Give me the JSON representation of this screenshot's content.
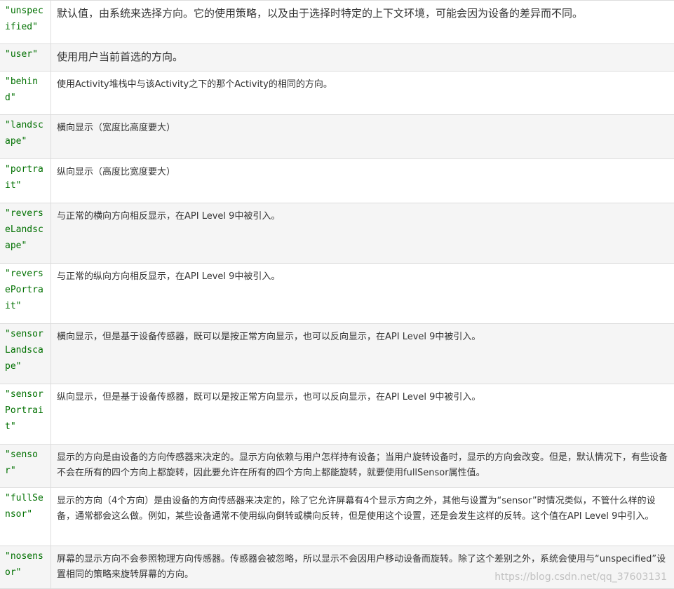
{
  "rows": [
    {
      "key": "\"unspecified\"",
      "desc": "默认值，由系统来选择方向。它的使用策略，以及由于选择时特定的上下文环境，可能会因为设备的差异而不同。"
    },
    {
      "key": "\"user\"",
      "desc": "使用用户当前首选的方向。"
    },
    {
      "key": "\"behind\"",
      "desc": "使用Activity堆栈中与该Activity之下的那个Activity的相同的方向。"
    },
    {
      "key": "\"landscape\"",
      "desc": "横向显示（宽度比高度要大）"
    },
    {
      "key": "\"portrait\"",
      "desc": "纵向显示（高度比宽度要大）"
    },
    {
      "key": "\"reverseLandscape\"",
      "desc": "与正常的横向方向相反显示，在API Level 9中被引入。"
    },
    {
      "key": "\"reversePortrait\"",
      "desc": "与正常的纵向方向相反显示，在API Level 9中被引入。"
    },
    {
      "key": "\"sensorLandscape\"",
      "desc": "横向显示，但是基于设备传感器，既可以是按正常方向显示，也可以反向显示，在API Level 9中被引入。"
    },
    {
      "key": "\"sensorPortrait\"",
      "desc": "纵向显示，但是基于设备传感器，既可以是按正常方向显示，也可以反向显示，在API Level 9中被引入。"
    },
    {
      "key": "\"sensor\"",
      "desc": "显示的方向是由设备的方向传感器来决定的。显示方向依赖与用户怎样持有设备；当用户旋转设备时，显示的方向会改变。但是，默认情况下，有些设备不会在所有的四个方向上都旋转，因此要允许在所有的四个方向上都能旋转，就要使用fullSensor属性值。"
    },
    {
      "key": "\"fullSensor\"",
      "desc": "显示的方向（4个方向）是由设备的方向传感器来决定的，除了它允许屏幕有4个显示方向之外，其他与设置为“sensor”时情况类似，不管什么样的设备，通常都会这么做。例如，某些设备通常不使用纵向倒转或横向反转，但是使用这个设置，还是会发生这样的反转。这个值在API Level 9中引入。"
    },
    {
      "key": "\"nosensor\"",
      "desc": "屏幕的显示方向不会参照物理方向传感器。传感器会被忽略，所以显示不会因用户移动设备而旋转。除了这个差别之外，系统会使用与“unspecified”设置相同的策略来旋转屏幕的方向。"
    }
  ],
  "watermark": "https://blog.csdn.net/qq_37603131"
}
